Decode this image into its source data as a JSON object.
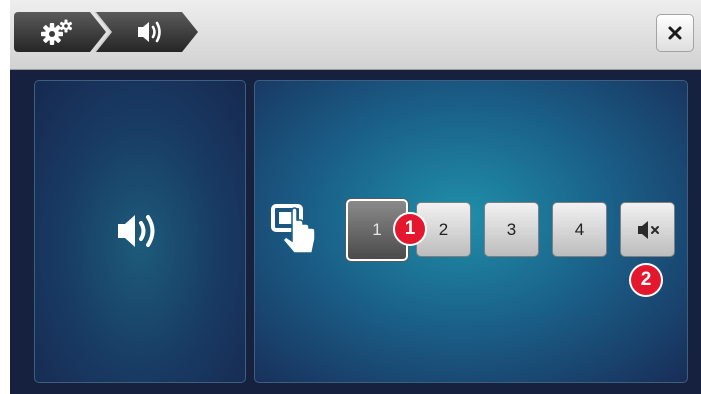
{
  "header": {
    "breadcrumb": [
      {
        "icon": "gears-icon"
      },
      {
        "icon": "speaker-volume-icon"
      }
    ],
    "close_icon": "close-icon"
  },
  "left_panel": {
    "icon": "speaker-volume-icon"
  },
  "right_panel": {
    "touch_icon": "touch-screen-icon",
    "volume_levels": [
      "1",
      "2",
      "3",
      "4"
    ],
    "selected_level": "1",
    "mute_icon": "speaker-mute-icon"
  },
  "annotations": {
    "badge_1": "1",
    "badge_2": "2"
  },
  "colors": {
    "badge": "#e3182e",
    "panel_accent": "#1f8fa9",
    "background": "#16213f"
  }
}
